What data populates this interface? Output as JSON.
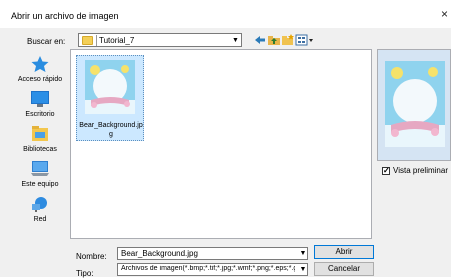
{
  "window": {
    "title": "Abrir un archivo de imagen",
    "close_glyph": "×"
  },
  "toolbar": {
    "lookin_label": "Buscar en:",
    "lookin_value": "Tutorial_7",
    "back_icon": "back-arrow-icon",
    "up_icon": "up-folder-icon",
    "newfolder_icon": "new-folder-icon",
    "views_icon": "views-menu-icon"
  },
  "places": [
    {
      "label": "Acceso rápido",
      "icon": "quick-access-star-icon"
    },
    {
      "label": "Escritorio",
      "icon": "desktop-icon"
    },
    {
      "label": "Bibliotecas",
      "icon": "libraries-icon"
    },
    {
      "label": "Este equipo",
      "icon": "this-pc-icon"
    },
    {
      "label": "Red",
      "icon": "network-icon"
    }
  ],
  "files": [
    {
      "name": "Bear_Background.jpg",
      "selected": true
    }
  ],
  "preview": {
    "checkbox_label": "Vista preliminar",
    "checked": true
  },
  "form": {
    "filename_label": "Nombre:",
    "filename_value": "Bear_Background.jpg",
    "filetype_label": "Tipo:",
    "filetype_value": "Archivos de imagen(*.bmp;*.tif;*.jpg;*.wmf;*.png;*.eps;*.gif)"
  },
  "buttons": {
    "open": "Abrir",
    "cancel": "Cancelar"
  },
  "colors": {
    "selection": "#cce8ff",
    "accent": "#0078d7",
    "folder": "#f3cf57"
  }
}
